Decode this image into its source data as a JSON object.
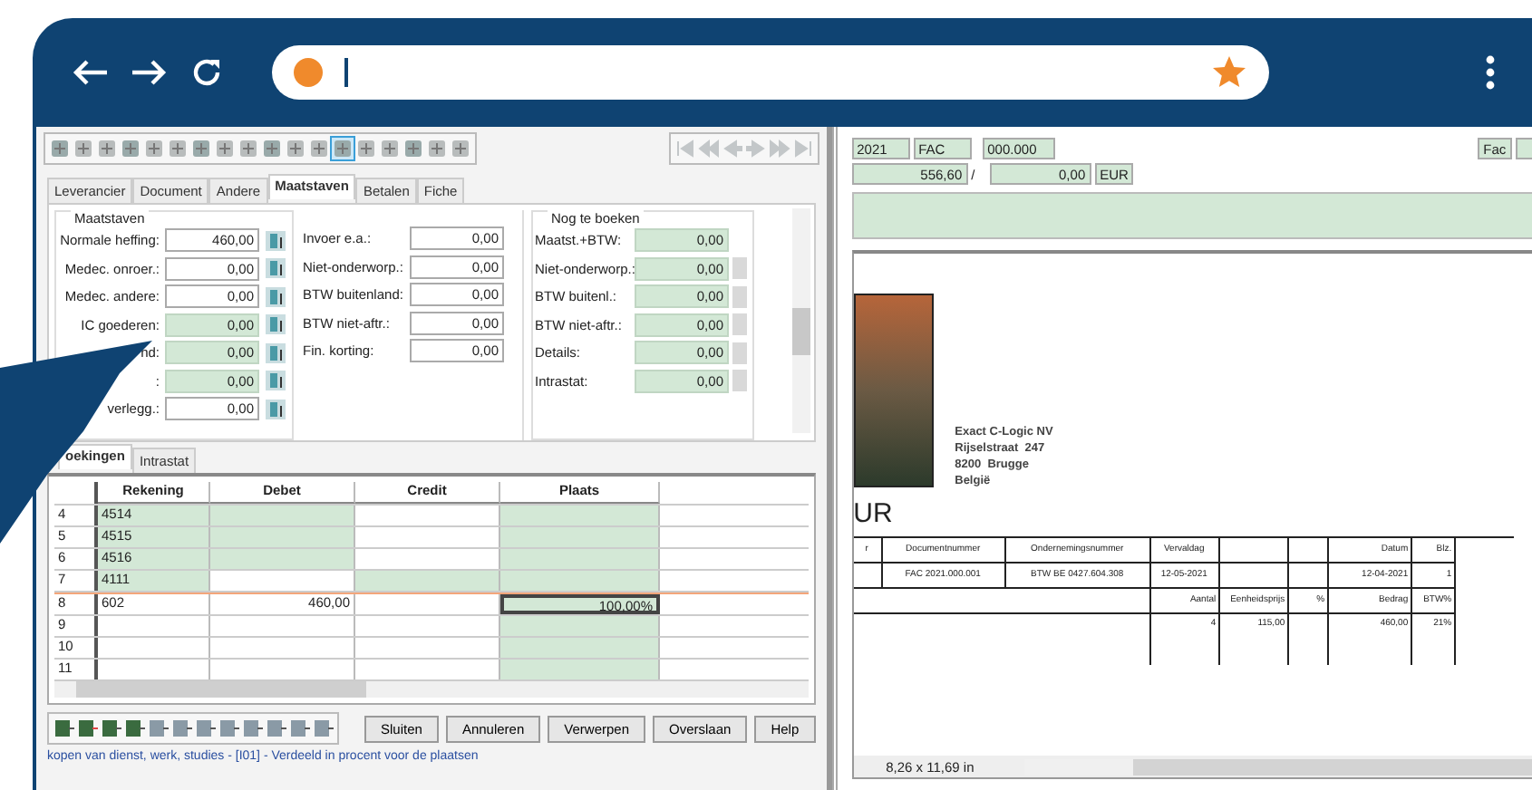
{
  "toolbar": {
    "disabled_nav": true
  },
  "tabs": [
    {
      "label": "Leverancier",
      "selected": false
    },
    {
      "label": "Document",
      "selected": false
    },
    {
      "label": "Andere",
      "selected": false
    },
    {
      "label": "Maatstaven",
      "selected": true
    },
    {
      "label": "Betalen",
      "selected": false
    },
    {
      "label": "Fiche",
      "selected": false
    }
  ],
  "maatstaven": {
    "title": "Maatstaven",
    "fields": [
      {
        "label": "Normale heffing:",
        "value": "460,00",
        "readonly": false
      },
      {
        "label": "Medec. onroer.:",
        "value": "0,00",
        "readonly": false
      },
      {
        "label": "Medec. andere:",
        "value": "0,00",
        "readonly": false
      },
      {
        "label": "IC goederen:",
        "value": "0,00",
        "readonly": true
      },
      {
        "label": "nd:",
        "value": "0,00",
        "readonly": true
      },
      {
        "label": ":",
        "value": "0,00",
        "readonly": true
      },
      {
        "label": "verlegg.:",
        "value": "0,00",
        "readonly": false
      }
    ]
  },
  "other_fields": [
    {
      "label": "Invoer e.a.:",
      "value": "0,00",
      "readonly": false
    },
    {
      "label": "Niet-onderworp.:",
      "value": "0,00",
      "readonly": false
    },
    {
      "label": "BTW buitenland:",
      "value": "0,00",
      "readonly": false
    },
    {
      "label": "BTW niet-aftr.:",
      "value": "0,00",
      "readonly": false
    },
    {
      "label": "Fin. korting:",
      "value": "0,00",
      "readonly": false
    }
  ],
  "nog_te_boeken": {
    "title": "Nog te boeken",
    "fields": [
      {
        "label": "Maatst.+BTW:",
        "value": "0,00",
        "readonly": true,
        "button": false
      },
      {
        "label": "Niet-onderworp.:",
        "value": "0,00",
        "readonly": true,
        "button": true
      },
      {
        "label": "BTW buitenl.:",
        "value": "0,00",
        "readonly": true,
        "button": true
      },
      {
        "label": "BTW niet-aftr.:",
        "value": "0,00",
        "readonly": true,
        "button": true
      },
      {
        "label": "Details:",
        "value": "0,00",
        "readonly": true,
        "button": true
      },
      {
        "label": "Intrastat:",
        "value": "0,00",
        "readonly": true,
        "button": true
      }
    ]
  },
  "lower_tabs": [
    {
      "label": "oekingen",
      "selected": true
    },
    {
      "label": "Intrastat",
      "selected": false
    }
  ],
  "grid": {
    "columns": [
      "Rekening",
      "Debet",
      "Credit",
      "Plaats"
    ],
    "rows": [
      {
        "number": "4",
        "selected": false,
        "cells": [
          {
            "text": "4514",
            "shaded": true
          },
          {
            "text": "",
            "shaded": true
          },
          {
            "text": "",
            "shaded": false
          },
          {
            "text": "",
            "shaded": true
          }
        ]
      },
      {
        "number": "5",
        "selected": false,
        "cells": [
          {
            "text": "4515",
            "shaded": true
          },
          {
            "text": "",
            "shaded": true
          },
          {
            "text": "",
            "shaded": false
          },
          {
            "text": "",
            "shaded": true
          }
        ]
      },
      {
        "number": "6",
        "selected": false,
        "cells": [
          {
            "text": "4516",
            "shaded": true
          },
          {
            "text": "",
            "shaded": true
          },
          {
            "text": "",
            "shaded": false
          },
          {
            "text": "",
            "shaded": true
          }
        ]
      },
      {
        "number": "7",
        "selected": false,
        "cells": [
          {
            "text": "4111",
            "shaded": true
          },
          {
            "text": "",
            "shaded": false
          },
          {
            "text": "",
            "shaded": true
          },
          {
            "text": "",
            "shaded": true
          }
        ]
      },
      {
        "number": "8",
        "selected": true,
        "cells": [
          {
            "text": "602",
            "shaded": false
          },
          {
            "text": "460,00",
            "shaded": false
          },
          {
            "text": "",
            "shaded": false
          },
          {
            "text": "100,00%",
            "shaded": true
          }
        ]
      },
      {
        "number": "9",
        "selected": false,
        "cells": [
          {
            "text": "",
            "shaded": false
          },
          {
            "text": "",
            "shaded": false
          },
          {
            "text": "",
            "shaded": false
          },
          {
            "text": "",
            "shaded": true
          }
        ]
      },
      {
        "number": "10",
        "selected": false,
        "cells": [
          {
            "text": "",
            "shaded": false
          },
          {
            "text": "",
            "shaded": false
          },
          {
            "text": "",
            "shaded": false
          },
          {
            "text": "",
            "shaded": true
          }
        ]
      },
      {
        "number": "11",
        "selected": false,
        "cells": [
          {
            "text": "",
            "shaded": false
          },
          {
            "text": "",
            "shaded": false
          },
          {
            "text": "",
            "shaded": false
          },
          {
            "text": "",
            "shaded": true
          }
        ]
      }
    ]
  },
  "buttons": [
    "Sluiten",
    "Annuleren",
    "Verwerpen",
    "Overslaan",
    "Help"
  ],
  "status_bar": "kopen van dienst, werk, studies - [I01] - Verdeeld in procent voor de plaatsen",
  "header": {
    "year": "2021",
    "journal": "FAC",
    "number": "000.000",
    "type": "Fac",
    "total": "556,60",
    "separator": "/",
    "amount": "0,00",
    "currency": "EUR"
  },
  "document": {
    "company": [
      "Exact C-Logic NV",
      "Rijselstraat  247",
      "8200  Brugge",
      "België"
    ],
    "title": "UR",
    "info_headings": [
      "r",
      "Documentnummer",
      "Ondernemingsnummer",
      "Vervaldag"
    ],
    "info_values": [
      "FAC 2021.000.001",
      "BTW BE 0427.604.308",
      "12-05-2021"
    ],
    "date_heading": "Datum",
    "page_heading": "Blz.",
    "date_value": "12-04-2021",
    "page_value": "1",
    "line_headings": [
      "Aantal",
      "Eenheidsprijs",
      "%",
      "Bedrag",
      "BTW%"
    ],
    "lines": [
      {
        "aantal": "4",
        "eenheidsprijs": "115,00",
        "bedrag": "460,00",
        "btw": "21%"
      }
    ],
    "page_size": "8,26 x 11,69 in"
  }
}
